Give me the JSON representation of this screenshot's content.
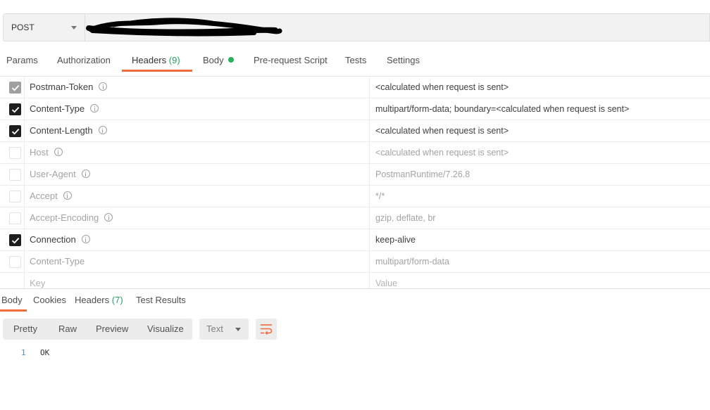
{
  "request": {
    "method": "POST",
    "url_redacted": true
  },
  "request_tabs": [
    {
      "label": "Params",
      "count": "",
      "active": false
    },
    {
      "label": "Authorization",
      "count": "",
      "active": false
    },
    {
      "label": "Headers",
      "count": "(9)",
      "active": true
    },
    {
      "label": "Body",
      "count": "",
      "active": false,
      "dot": true
    },
    {
      "label": "Pre-request Script",
      "count": "",
      "active": false
    },
    {
      "label": "Tests",
      "count": "",
      "active": false
    },
    {
      "label": "Settings",
      "count": "",
      "active": false
    }
  ],
  "headers": [
    {
      "key": "Postman-Token",
      "value": "<calculated when request is sent>",
      "checked": true,
      "disabled": true,
      "info": true
    },
    {
      "key": "Content-Type",
      "value": "multipart/form-data; boundary=<calculated when request is sent>",
      "checked": true,
      "disabled": false,
      "info": true
    },
    {
      "key": "Content-Length",
      "value": "<calculated when request is sent>",
      "checked": true,
      "disabled": false,
      "info": true
    },
    {
      "key": "Host",
      "value": "<calculated when request is sent>",
      "checked": false,
      "disabled": false,
      "info": true
    },
    {
      "key": "User-Agent",
      "value": "PostmanRuntime/7.26.8",
      "checked": false,
      "disabled": false,
      "info": true
    },
    {
      "key": "Accept",
      "value": "*/*",
      "checked": false,
      "disabled": false,
      "info": true
    },
    {
      "key": "Accept-Encoding",
      "value": "gzip, deflate, br",
      "checked": false,
      "disabled": false,
      "info": true
    },
    {
      "key": "Connection",
      "value": "keep-alive",
      "checked": true,
      "disabled": false,
      "info": true
    },
    {
      "key": "Content-Type",
      "value": "multipart/form-data",
      "checked": false,
      "disabled": false,
      "info": false
    }
  ],
  "new_header": {
    "key_placeholder": "Key",
    "value_placeholder": "Value"
  },
  "response_tabs": [
    {
      "label": "Body",
      "count": "",
      "active": true
    },
    {
      "label": "Cookies",
      "count": "",
      "active": false
    },
    {
      "label": "Headers",
      "count": "(7)",
      "active": false
    },
    {
      "label": "Test Results",
      "count": "",
      "active": false
    }
  ],
  "format_buttons": [
    "Pretty",
    "Raw",
    "Preview",
    "Visualize"
  ],
  "format_select": "Text",
  "response_body": [
    {
      "line": "1",
      "text": "OK"
    }
  ],
  "colors": {
    "accent": "#f26b3a",
    "count_green": "#26a269",
    "body_dot": "#26b15a"
  }
}
